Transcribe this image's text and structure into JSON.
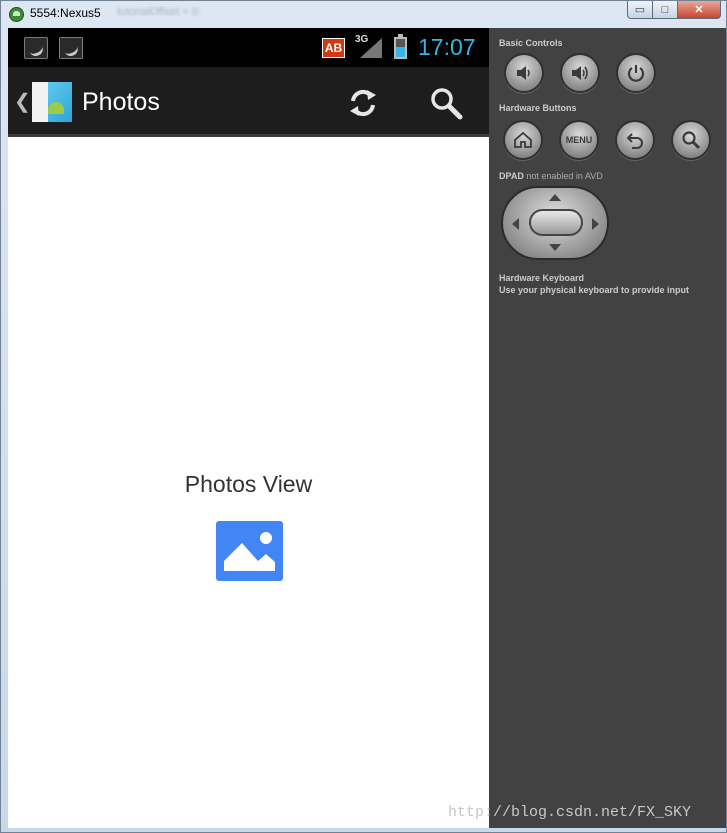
{
  "window": {
    "title": "5554:Nexus5",
    "ghost_title": "tutorialOffset = 0;",
    "controls": {
      "minimize": "▭",
      "maximize": "□",
      "close": "✕"
    }
  },
  "statusbar": {
    "notifications": [
      "android-notification-icon",
      "android-notification-icon"
    ],
    "ab_badge": "AB",
    "network": "3G",
    "time": "17:07",
    "battery_level": 0.55,
    "accent_color": "#33b5e5"
  },
  "actionbar": {
    "title": "Photos",
    "up_glyph": "❮",
    "actions": [
      "refresh-icon",
      "search-icon"
    ]
  },
  "content": {
    "label": "Photos View",
    "icon": "photo-icon",
    "icon_color": "#4285f4"
  },
  "panel": {
    "basic_controls": "Basic Controls",
    "hardware_buttons": "Hardware Buttons",
    "menu_label": "MENU",
    "dpad_label": "DPAD",
    "dpad_note": "not enabled in AVD",
    "keyboard_title": "Hardware Keyboard",
    "keyboard_text": "Use your physical keyboard to provide input"
  },
  "watermark": "http://blog.csdn.net/FX_SKY"
}
